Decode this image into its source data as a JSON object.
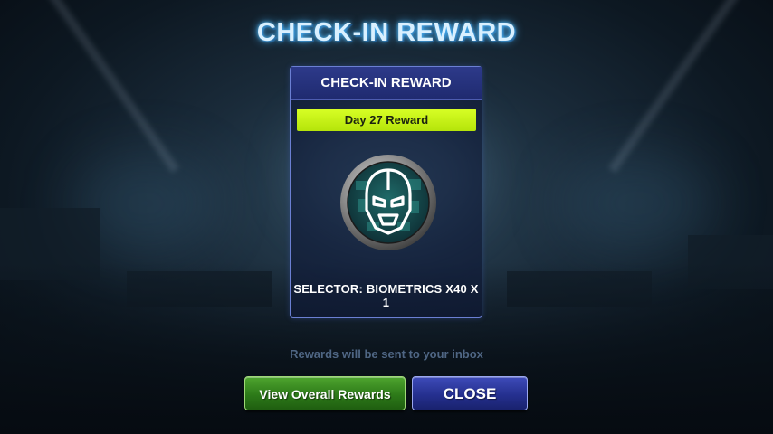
{
  "screen": {
    "title": "CHECK-IN REWARD",
    "inbox_note": "Rewards will be sent to your inbox"
  },
  "card": {
    "header": "CHECK-IN REWARD",
    "day_label": "Day 27 Reward",
    "reward_name": "SELECTOR: BIOMETRICS X40 X 1",
    "reward_icon": "iron-helmet-biometrics-icon"
  },
  "buttons": {
    "view_overall": "View Overall Rewards",
    "close": "CLOSE"
  },
  "colors": {
    "title_glow": "#4ab5ff",
    "day_banner": "#c8f51a",
    "card_border": "#6b7fd3",
    "green_button": "#2d7a19",
    "blue_button": "#25308f"
  }
}
